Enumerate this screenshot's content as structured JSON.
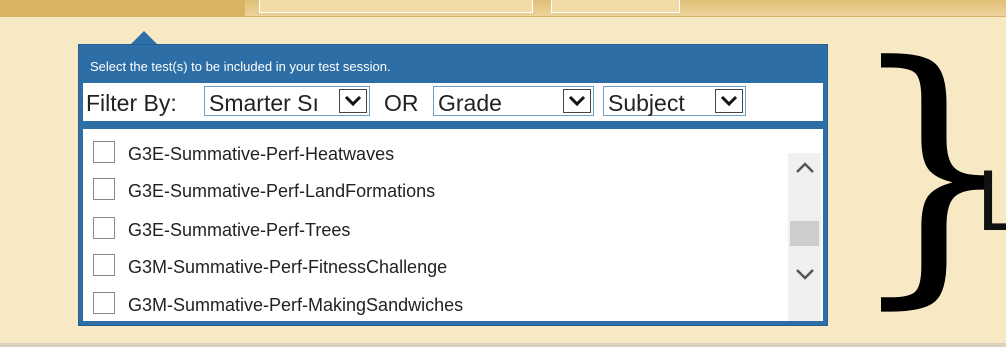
{
  "instruction": "Select the test(s) to be included in your test session.",
  "filter": {
    "label": "Filter By:",
    "or_label": "OR",
    "assessment_value": "Smarter Sı",
    "grade_value": "Grade",
    "subject_value": "Subject"
  },
  "tests": [
    {
      "label": "G3E-Summative-Perf-Heatwaves",
      "checked": false
    },
    {
      "label": "G3E-Summative-Perf-LandFormations",
      "checked": false
    },
    {
      "label": "G3E-Summative-Perf-Trees",
      "checked": false
    },
    {
      "label": "G3M-Summative-Perf-FitnessChallenge",
      "checked": false
    },
    {
      "label": "G3M-Summative-Perf-MakingSandwiches",
      "checked": false
    }
  ],
  "side_letter": "L",
  "colors": {
    "panel": "#2d6ea6",
    "background": "#f8e9c5"
  }
}
